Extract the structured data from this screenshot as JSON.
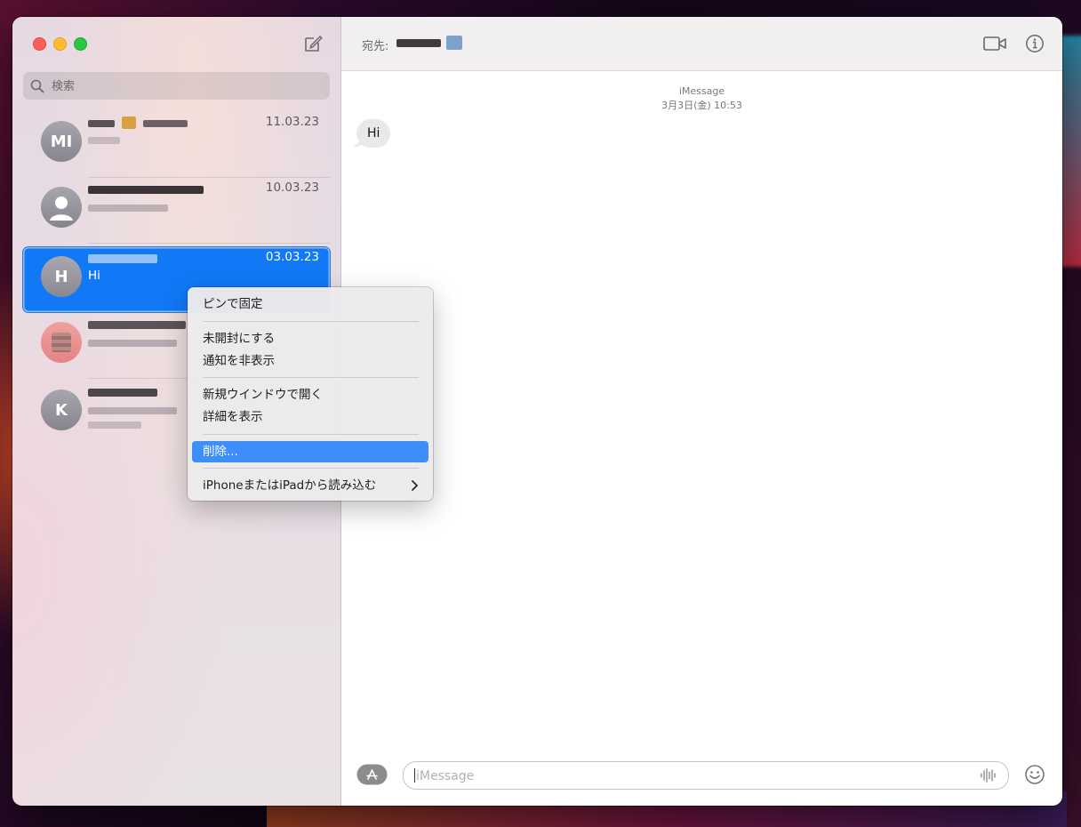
{
  "window": {
    "search_placeholder": "検索",
    "conversations": [
      {
        "avatar": "MI",
        "date": "11.03.23",
        "preview": ""
      },
      {
        "avatar": "",
        "date": "10.03.23",
        "preview": ""
      },
      {
        "avatar": "H",
        "date": "03.03.23",
        "preview": "Hi",
        "selected": true
      },
      {
        "avatar": "",
        "date": "",
        "preview": ""
      },
      {
        "avatar": "K",
        "date": "",
        "preview": ""
      }
    ]
  },
  "main": {
    "to_label": "宛先:",
    "service": "iMessage",
    "timestamp": "3月3日(金) 10:53",
    "message": "Hi",
    "input_placeholder": "iMessage"
  },
  "context_menu": {
    "items": [
      "ピンで固定",
      "未開封にする",
      "通知を非表示",
      "新規ウインドウで開く",
      "詳細を表示",
      "削除...",
      "iPhoneまたはiPadから読み込む"
    ],
    "highlighted": "削除..."
  },
  "colors": {
    "selection": "#1178f6",
    "menu_highlight": "#3d8ef8",
    "close": "#ff5f57",
    "minimize": "#febc2e",
    "maximize": "#28c840"
  }
}
